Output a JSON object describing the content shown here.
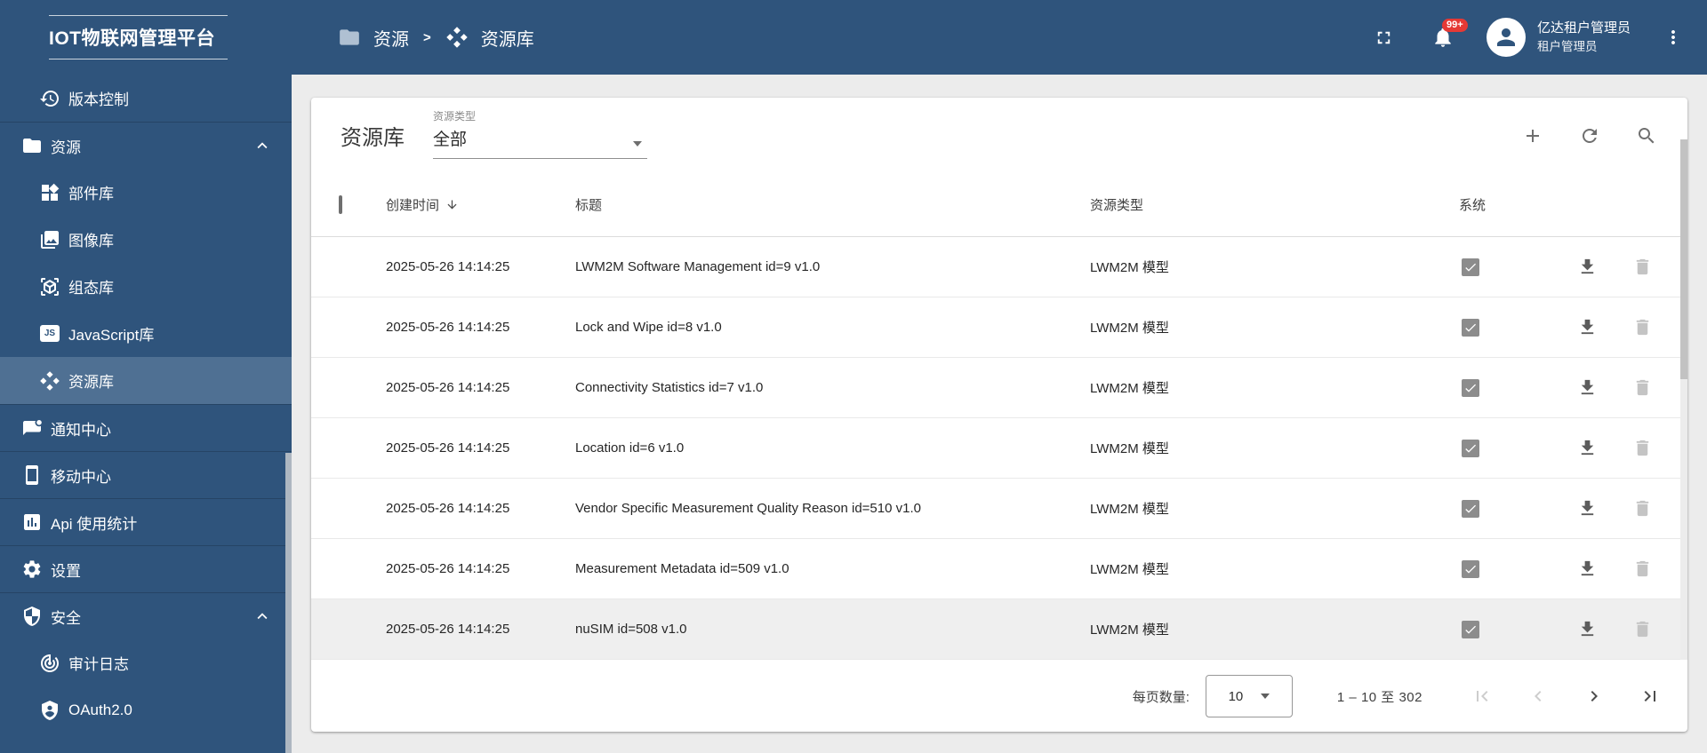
{
  "colors": {
    "topbar_bg": "#2F547C",
    "sidebar_bg": "#2F547C",
    "sidebar_selected_bg": "#4F7093",
    "badge_bg": "#E53935",
    "system_checkbox": "#8C8C8C"
  },
  "app": {
    "title": "IOT物联网管理平台"
  },
  "header": {
    "breadcrumb": {
      "section": "资源",
      "separator": ">",
      "page": "资源库"
    },
    "notifications_badge": "99+",
    "user": {
      "name": "亿达租户管理员",
      "role": "租户管理员"
    }
  },
  "sidebar": {
    "items": [
      {
        "key": "version-control",
        "label": "版本控制",
        "icon": "history-icon",
        "level": "sub"
      },
      {
        "key": "resources",
        "label": "资源",
        "icon": "folder-icon",
        "level": "top",
        "expanded": true,
        "divider": true
      },
      {
        "key": "widget-library",
        "label": "部件库",
        "icon": "widgets-icon",
        "level": "sub"
      },
      {
        "key": "image-library",
        "label": "图像库",
        "icon": "photo-library-icon",
        "level": "sub"
      },
      {
        "key": "scada-library",
        "label": "组态库",
        "icon": "cube-icon",
        "level": "sub"
      },
      {
        "key": "javascript-library",
        "label": "JavaScript库",
        "icon": "js-icon",
        "level": "sub"
      },
      {
        "key": "resource-library",
        "label": "资源库",
        "icon": "diamonds-icon",
        "level": "sub",
        "selected": true
      },
      {
        "key": "notification-center",
        "label": "通知中心",
        "icon": "chat-alert-icon",
        "level": "top",
        "divider": true
      },
      {
        "key": "mobile-center",
        "label": "移动中心",
        "icon": "smartphone-icon",
        "level": "top",
        "divider": true
      },
      {
        "key": "api-usage",
        "label": "Api 使用统计",
        "icon": "bar-chart-icon",
        "level": "top",
        "divider": true
      },
      {
        "key": "settings",
        "label": "设置",
        "icon": "gear-icon",
        "level": "top",
        "divider": true
      },
      {
        "key": "security",
        "label": "安全",
        "icon": "shield-icon",
        "level": "top",
        "expanded": true,
        "divider": true
      },
      {
        "key": "audit-log",
        "label": "审计日志",
        "icon": "track-changes-icon",
        "level": "sub"
      },
      {
        "key": "oauth2",
        "label": "OAuth2.0",
        "icon": "shield-person-icon",
        "level": "sub"
      }
    ]
  },
  "toolbar": {
    "title": "资源库",
    "filter_label": "资源类型",
    "filter_value": "全部"
  },
  "table": {
    "headers": {
      "created": "创建时间",
      "title": "标题",
      "type": "资源类型",
      "system": "系统"
    },
    "sort": {
      "column": "创建时间",
      "direction": "desc"
    },
    "rows": [
      {
        "created": "2025-05-26 14:14:25",
        "title": "LWM2M Software Management id=9 v1.0",
        "type": "LWM2M 模型",
        "system": true
      },
      {
        "created": "2025-05-26 14:14:25",
        "title": "Lock and Wipe id=8 v1.0",
        "type": "LWM2M 模型",
        "system": true
      },
      {
        "created": "2025-05-26 14:14:25",
        "title": "Connectivity Statistics id=7 v1.0",
        "type": "LWM2M 模型",
        "system": true
      },
      {
        "created": "2025-05-26 14:14:25",
        "title": "Location id=6 v1.0",
        "type": "LWM2M 模型",
        "system": true
      },
      {
        "created": "2025-05-26 14:14:25",
        "title": "Vendor Specific Measurement Quality Reason id=510 v1.0",
        "type": "LWM2M 模型",
        "system": true
      },
      {
        "created": "2025-05-26 14:14:25",
        "title": "Measurement Metadata id=509 v1.0",
        "type": "LWM2M 模型",
        "system": true
      },
      {
        "created": "2025-05-26 14:14:25",
        "title": "nuSIM id=508 v1.0",
        "type": "LWM2M 模型",
        "system": true,
        "hovered": true
      }
    ]
  },
  "pagination": {
    "per_page_label": "每页数量:",
    "per_page_value": "10",
    "range_text": "1 – 10 至 302"
  }
}
